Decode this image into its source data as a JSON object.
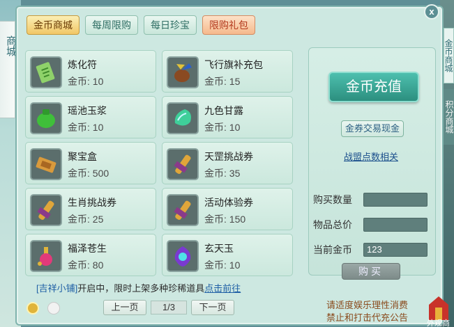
{
  "left_scroll": {
    "text": "商城"
  },
  "right_edge": {
    "text_top": "金币商城",
    "text_mid": "积分商城",
    "text_bottom": "外观商"
  },
  "tabs": [
    {
      "label": "金币商城",
      "state": "active"
    },
    {
      "label": "每周限购",
      "state": "normal"
    },
    {
      "label": "每日珍宝",
      "state": "normal"
    },
    {
      "label": "限购礼包",
      "state": "limited"
    }
  ],
  "items": [
    {
      "name": "炼化符",
      "price_label": "金币:",
      "price": "10",
      "icon": "talisman-icon"
    },
    {
      "name": "飞行旗补充包",
      "price_label": "金币:",
      "price": "15",
      "icon": "flag-pack-icon"
    },
    {
      "name": "瑶池玉浆",
      "price_label": "金币:",
      "price": "10",
      "icon": "jade-jar-icon"
    },
    {
      "name": "九色甘露",
      "price_label": "金币:",
      "price": "10",
      "icon": "dew-gem-icon"
    },
    {
      "name": "聚宝盒",
      "price_label": "金币:",
      "price": "500",
      "icon": "treasure-box-icon"
    },
    {
      "name": "天罡挑战券",
      "price_label": "金币:",
      "price": "35",
      "icon": "scroll-icon"
    },
    {
      "name": "生肖挑战券",
      "price_label": "金币:",
      "price": "25",
      "icon": "scroll-icon"
    },
    {
      "name": "活动体验券",
      "price_label": "金币:",
      "price": "150",
      "icon": "scroll-icon"
    },
    {
      "name": "福泽苍生",
      "price_label": "金币:",
      "price": "80",
      "icon": "potion-icon"
    },
    {
      "name": "玄天玉",
      "price_label": "金币:",
      "price": "10",
      "icon": "purple-jade-icon"
    }
  ],
  "right_panel": {
    "recharge_label": "金币充值",
    "exchange_label": "金券交易现金",
    "alliance_link": "战盟点数相关",
    "qty_label": "购买数量",
    "qty_value": "",
    "total_label": "物品总价",
    "total_value": "",
    "gold_label": "当前金币",
    "gold_value": "123",
    "buy_label": "购买"
  },
  "notice": {
    "shop_name": "[吉祥小铺]",
    "text": "开启中，限时上架多种珍稀道具",
    "link": "点击前往"
  },
  "pager": {
    "prev": "上一页",
    "page": "1/3",
    "next": "下一页"
  },
  "warnings": {
    "line1": "请适度娱乐理性消费",
    "line2": "禁止和打击代充公告"
  },
  "close_label": "x",
  "colors": {
    "accent": "#2c8f7f",
    "panel": "#cde8e1",
    "link": "#1f5fa5"
  }
}
